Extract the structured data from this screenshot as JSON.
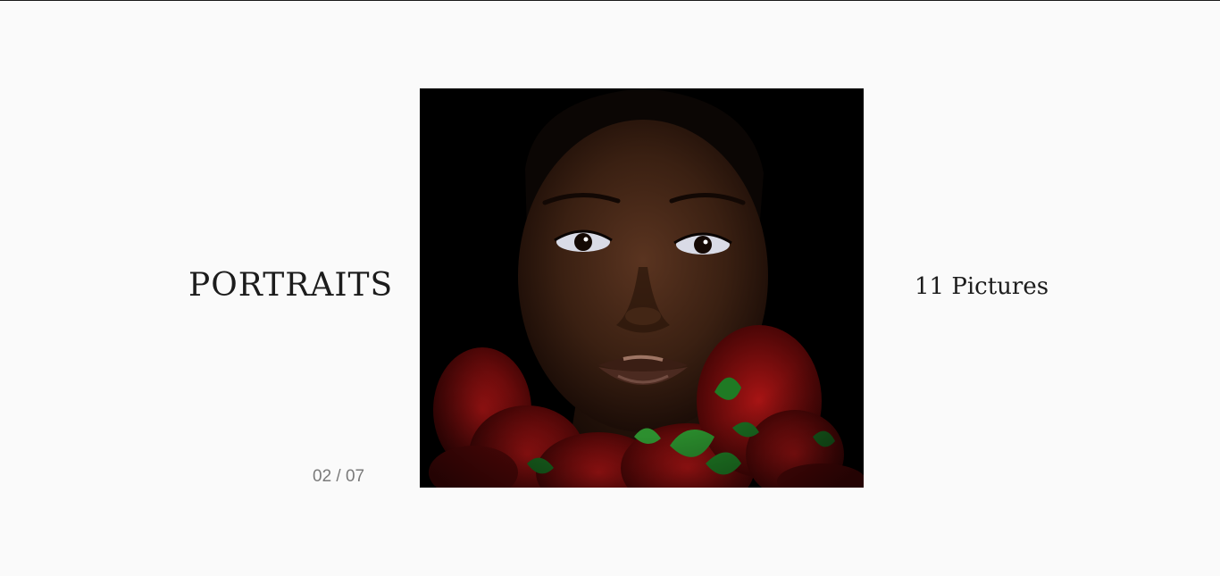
{
  "gallery": {
    "title": "PORTRAITS",
    "counter": "02 / 07",
    "picture_count": "11 Pictures"
  },
  "image": {
    "alt": "Portrait of a woman with dark skin on a black background, wearing a red flower lei with green leaves",
    "background_color": "#000000",
    "skin_tone": "#3a2012",
    "flower_color": "#8b0d0d",
    "leaf_color": "#1f7a24"
  },
  "colors": {
    "page_background": "#fafafa",
    "text_primary": "#1c1c1c",
    "text_muted": "#7a7a7a"
  }
}
